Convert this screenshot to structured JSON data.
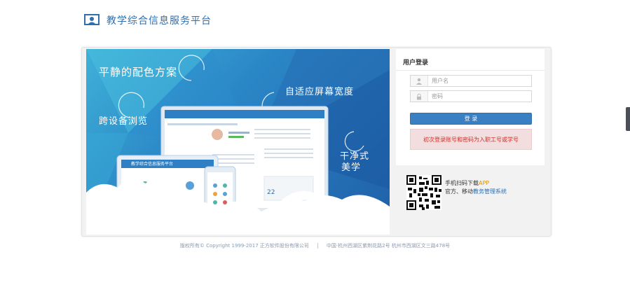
{
  "header": {
    "title": "教学综合信息服务平台"
  },
  "banner": {
    "slogan_1": "平静的配色方案",
    "slogan_2": "自适应屏幕宽度",
    "slogan_3": "跨设备浏览",
    "slogan_4_line1": "干净式",
    "slogan_4_line2": "美学",
    "tablet_title": "教学综合信息服务平台",
    "calendar_day": "22"
  },
  "login": {
    "title": "用户登录",
    "username_placeholder": "用户名",
    "password_placeholder": "密码",
    "button_label": "登 录",
    "error_message": "初次登录账号和密码为入职工号或学号"
  },
  "qr": {
    "line1_prefix": "手机扫码下载",
    "line1_highlight": "APP",
    "line2_prefix": "官方、移动",
    "line2_link": "教务管理系统"
  },
  "footer": {
    "copyright": "版权所有© Copyright 1999-2017 正方软件股份有限公司",
    "address": "中国·杭州西湖区紫荆花路2号 杭州市西湖区文三路478号"
  },
  "colors": {
    "primary": "#3a7fc1",
    "alert_bg": "#f2dede",
    "alert_text": "#c9302c"
  }
}
